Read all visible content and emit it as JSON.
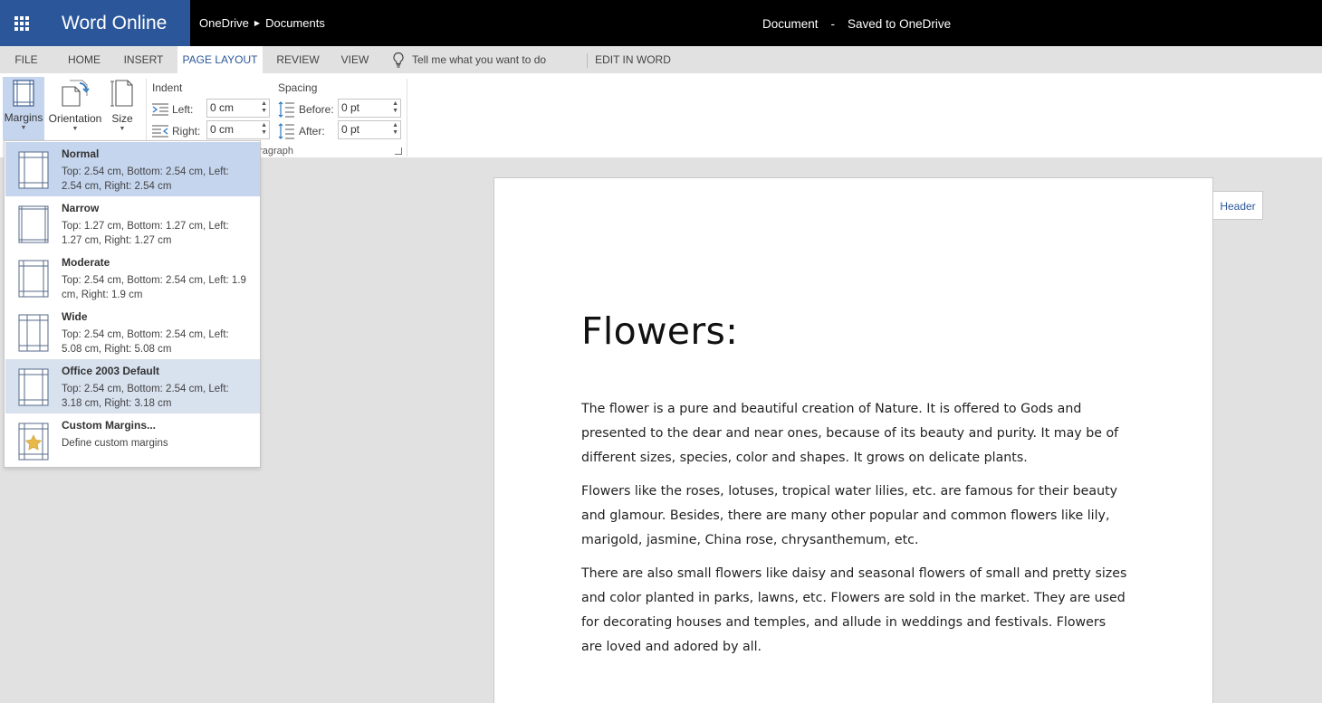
{
  "titlebar": {
    "app_name": "Word Online",
    "breadcrumb": [
      "OneDrive",
      "Documents"
    ],
    "doc_name": "Document",
    "separator": "-",
    "save_status": "Saved to OneDrive"
  },
  "tabs": [
    {
      "label": "FILE"
    },
    {
      "label": "HOME"
    },
    {
      "label": "INSERT"
    },
    {
      "label": "PAGE LAYOUT",
      "active": true
    },
    {
      "label": "REVIEW"
    },
    {
      "label": "VIEW"
    }
  ],
  "tell_me": {
    "placeholder": "Tell me what you want to do"
  },
  "edit_in_word": "EDIT IN WORD",
  "ribbon": {
    "margins_label": "Margins",
    "orientation_label": "Orientation",
    "size_label": "Size",
    "indent_title": "Indent",
    "indent_left_label": "Left:",
    "indent_left_value": "0 cm",
    "indent_right_label": "Right:",
    "indent_right_value": "0 cm",
    "spacing_title": "Spacing",
    "spacing_before_label": "Before:",
    "spacing_before_value": "0 pt",
    "spacing_after_label": "After:",
    "spacing_after_value": "0 pt",
    "paragraph_group_label": "aragraph"
  },
  "margins_menu": {
    "items": [
      {
        "name": "Normal",
        "desc": "Top: 2.54 cm, Bottom: 2.54 cm, Left: 2.54 cm, Right: 2.54 cm",
        "state": "selected"
      },
      {
        "name": "Narrow",
        "desc": "Top: 1.27 cm, Bottom: 1.27 cm, Left: 1.27 cm, Right: 1.27 cm"
      },
      {
        "name": "Moderate",
        "desc": "Top: 2.54 cm, Bottom: 2.54 cm, Left: 1.9 cm, Right: 1.9 cm"
      },
      {
        "name": "Wide",
        "desc": "Top: 2.54 cm, Bottom: 2.54 cm, Left: 5.08 cm, Right: 5.08 cm"
      },
      {
        "name": "Office 2003 Default",
        "desc": "Top: 2.54 cm, Bottom: 2.54 cm, Left: 3.18 cm, Right: 3.18 cm",
        "state": "hover"
      },
      {
        "name": "Custom Margins...",
        "desc": "Define custom margins"
      }
    ]
  },
  "document": {
    "title": "Flowers:",
    "paragraphs": [
      "The flower is a pure and beautiful creation of Nature. It is offered to Gods and presented to the dear and near ones, because of its beauty and purity. It may be of different sizes, species, color and shapes. It grows on delicate plants.",
      "Flowers like the roses, lotuses, tropical water lilies, etc. are famous for their beauty and glamour. Besides, there are many other popular and common flowers like lily, marigold, jasmine, China rose, chrysanthemum, etc.",
      "There are also small flowers like daisy and seasonal flowers of small and pretty sizes and color planted in parks, lawns, etc. Flowers are sold in the market. They are used for decorating houses and temples, and allude in weddings and festivals. Flowers are loved and adored by all."
    ],
    "header_button": "Header"
  },
  "icons": {
    "app_launcher": "waffle-icon",
    "tell_me": "lightbulb-icon",
    "custom_margins": "star-icon"
  },
  "colors": {
    "brand": "#2b579a",
    "titlebar_bg": "#000000",
    "selected_item": "#c5d5ee",
    "hover_item": "#d8e1ee",
    "workspace_bg": "#e1e1e1"
  }
}
